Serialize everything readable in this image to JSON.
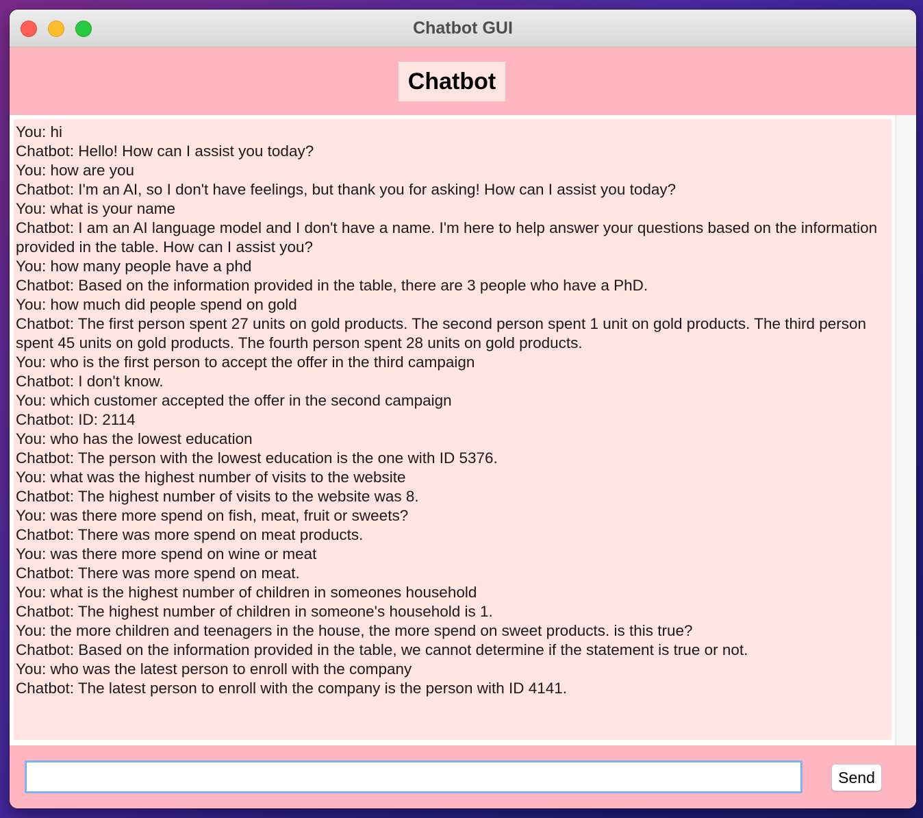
{
  "window": {
    "title": "Chatbot GUI"
  },
  "header": {
    "title": "Chatbot"
  },
  "chat": {
    "lines": [
      "You: hi",
      "Chatbot: Hello! How can I assist you today?",
      "You: how are you",
      "Chatbot: I'm an AI, so I don't have feelings, but thank you for asking! How can I assist you today?",
      "You: what is your name",
      "Chatbot: I am an AI language model and I don't have a name. I'm here to help answer your questions based on the information provided in the table. How can I assist you?",
      "You: how many people have a phd",
      "Chatbot: Based on the information provided in the table, there are 3 people who have a PhD.",
      "You: how much did people spend on gold",
      "Chatbot: The first person spent 27 units on gold products. The second person spent 1 unit on gold products. The third person spent 45 units on gold products. The fourth person spent 28 units on gold products.",
      "You: who is the first person to accept the offer in the third campaign",
      "Chatbot: I don't know.",
      "You: which customer accepted the offer in the second campaign",
      "Chatbot: ID: 2114",
      "You: who has the lowest education",
      "Chatbot: The person with the lowest education is the one with ID 5376.",
      "You: what was the highest number of visits to the website",
      "Chatbot: The highest number of visits to the website was 8.",
      "You: was there more spend on fish, meat, fruit or sweets?",
      "Chatbot: There was more spend on meat products.",
      "You: was there more spend on wine or meat",
      "Chatbot: There was more spend on meat.",
      "You: what is the highest number of children in someones household",
      "Chatbot: The highest number of children in someone's household is 1.",
      "You: the more children and teenagers in the house, the more spend on sweet products. is this true?",
      "Chatbot: Based on the information provided in the table, we cannot determine if the statement is true or not.",
      "You: who was the latest person to enroll with the company",
      "Chatbot: The latest person to enroll with the company is the person with ID 4141."
    ]
  },
  "input": {
    "value": "",
    "placeholder": ""
  },
  "send": {
    "label": "Send"
  },
  "colors": {
    "header_background": "#ffb6c1",
    "title_background": "#ffe4e1",
    "chat_background": "#ffe4e1",
    "input_focus_border": "#7fb2f0"
  }
}
